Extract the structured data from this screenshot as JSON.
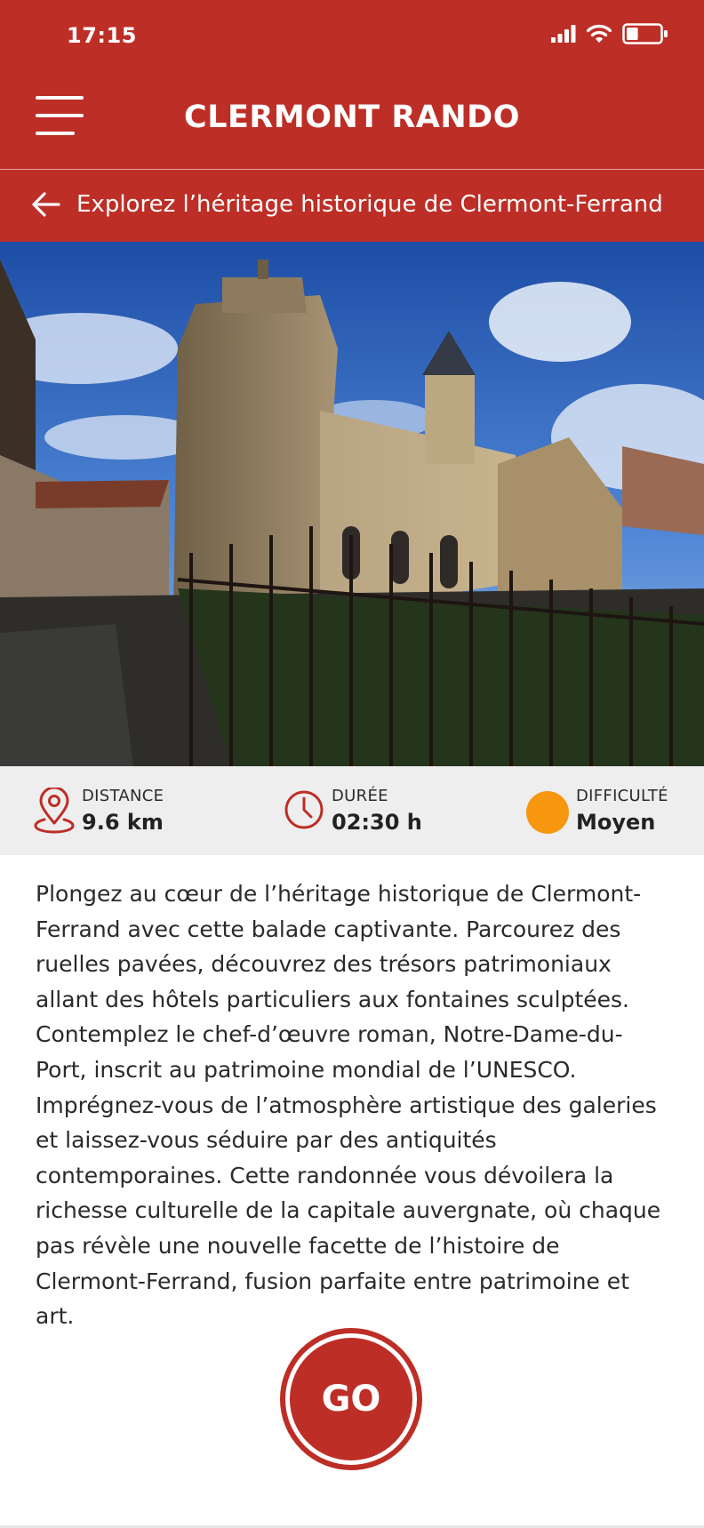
{
  "status_bar": {
    "time": "17:15",
    "battery_level": 0.35
  },
  "header": {
    "title": "CLERMONT RANDO"
  },
  "subheader": {
    "title": "Explorez l’héritage historique de Clermont-Ferrand"
  },
  "stats": {
    "distance": {
      "label": "DISTANCE",
      "value": "9.6 km"
    },
    "duration": {
      "label": "DURÉE",
      "value": "02:30 h"
    },
    "difficulty": {
      "label": "DIFFICULTÉ",
      "value": "Moyen",
      "color": "#f7960f"
    }
  },
  "description": "Plongez au cœur de l’héritage historique de Clermont-Ferrand avec cette balade captivante. Parcourez des ruelles pavées, découvrez des trésors patrimoniaux allant des hôtels particuliers aux fontaines sculptées. Contemplez le chef-d’œuvre roman, Notre-Dame-du-Port, inscrit au patrimoine mondial de l’UNESCO. Imprégnez-vous de l’atmosphère artistique des galeries et laissez-vous séduire par des antiquités contemporaines. Cette randonnée vous dévoilera la richesse culturelle de la capitale auvergnate, où chaque pas révèle une nouvelle facette de l’histoire de Clermont-Ferrand, fusion parfaite entre patrimoine et art.",
  "go_button": {
    "label": "GO"
  },
  "colors": {
    "brand_red": "#bd2e26",
    "stats_bg": "#eeeeee",
    "difficulty_orange": "#f7960f"
  },
  "icons": {
    "menu": "hamburger-menu-icon",
    "back": "arrow-left-icon",
    "distance": "location-pin-icon",
    "duration": "clock-icon",
    "signal": "cellular-signal-icon",
    "wifi": "wifi-icon",
    "battery": "battery-icon"
  }
}
